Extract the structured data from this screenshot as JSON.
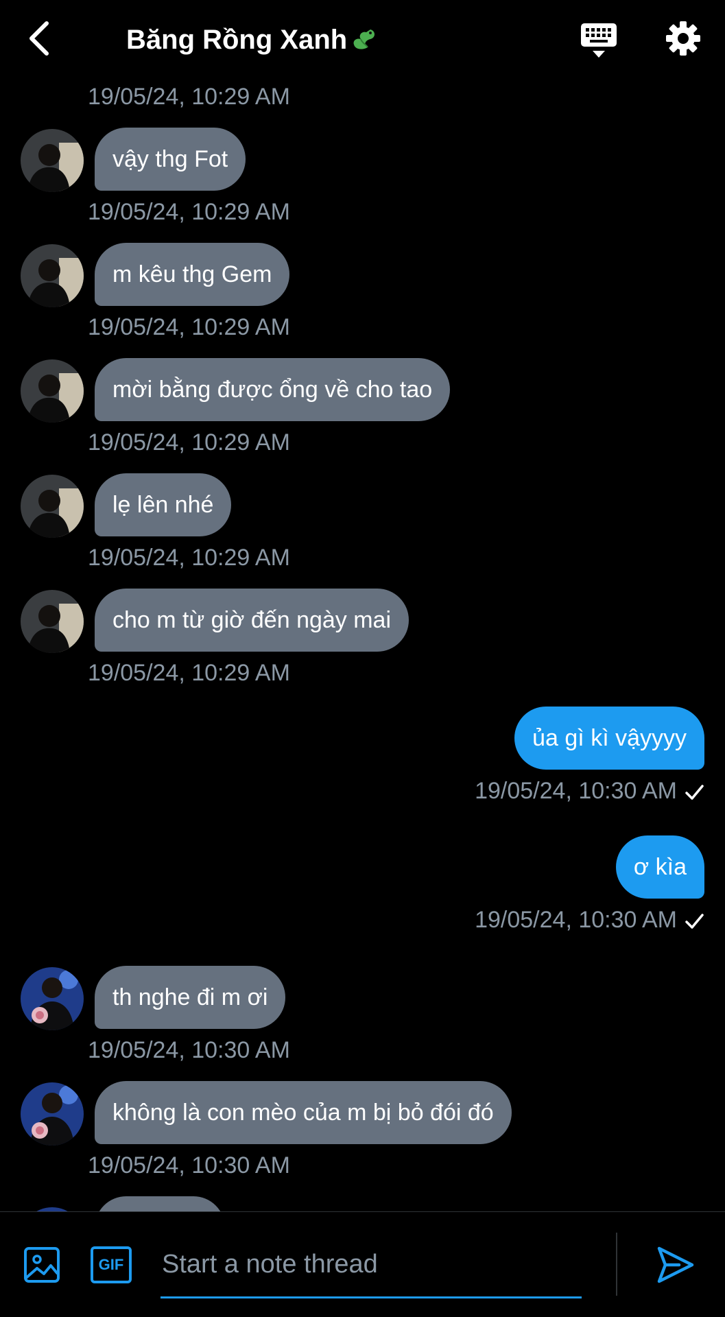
{
  "header": {
    "title": "Băng Rồng Xanh",
    "title_emoji": "dragon-icon",
    "back_icon": "chevron-left-icon",
    "keyboard_icon": "keyboard-icon",
    "settings_icon": "gear-icon"
  },
  "colors": {
    "background": "#000000",
    "received_bubble": "#66717f",
    "sent_bubble": "#1d9bf0",
    "timestamp": "#8b98a5",
    "accent": "#1d9bf0"
  },
  "thread": {
    "top_timestamp": "19/05/24, 10:29 AM",
    "messages": [
      {
        "direction": "received",
        "text": "vậy thg Fot",
        "timestamp": "19/05/24, 10:29 AM"
      },
      {
        "direction": "received",
        "text": "m kêu thg Gem",
        "timestamp": "19/05/24, 10:29 AM"
      },
      {
        "direction": "received",
        "text": "mời bằng được ổng về cho tao",
        "timestamp": "19/05/24, 10:29 AM"
      },
      {
        "direction": "received",
        "text": "lẹ lên nhé",
        "timestamp": "19/05/24, 10:29 AM"
      },
      {
        "direction": "received",
        "text": "cho m từ giờ đến ngày mai",
        "timestamp": "19/05/24, 10:29 AM"
      },
      {
        "direction": "sent",
        "text": "ủa gì kì vậyyyy",
        "timestamp": "19/05/24, 10:30 AM",
        "read": true
      },
      {
        "direction": "sent",
        "text": "ơ kìa",
        "timestamp": "19/05/24, 10:30 AM",
        "read": true
      },
      {
        "direction": "received",
        "text": "th nghe đi m ơi",
        "timestamp": "19/05/24, 10:30 AM"
      },
      {
        "direction": "received",
        "text": "không là con mèo của m bị bỏ đói đó",
        "timestamp": "19/05/24, 10:30 AM"
      }
    ]
  },
  "composer": {
    "placeholder": "Start a note thread",
    "image_icon": "image-icon",
    "gif_label": "GIF",
    "send_icon": "send-icon"
  }
}
